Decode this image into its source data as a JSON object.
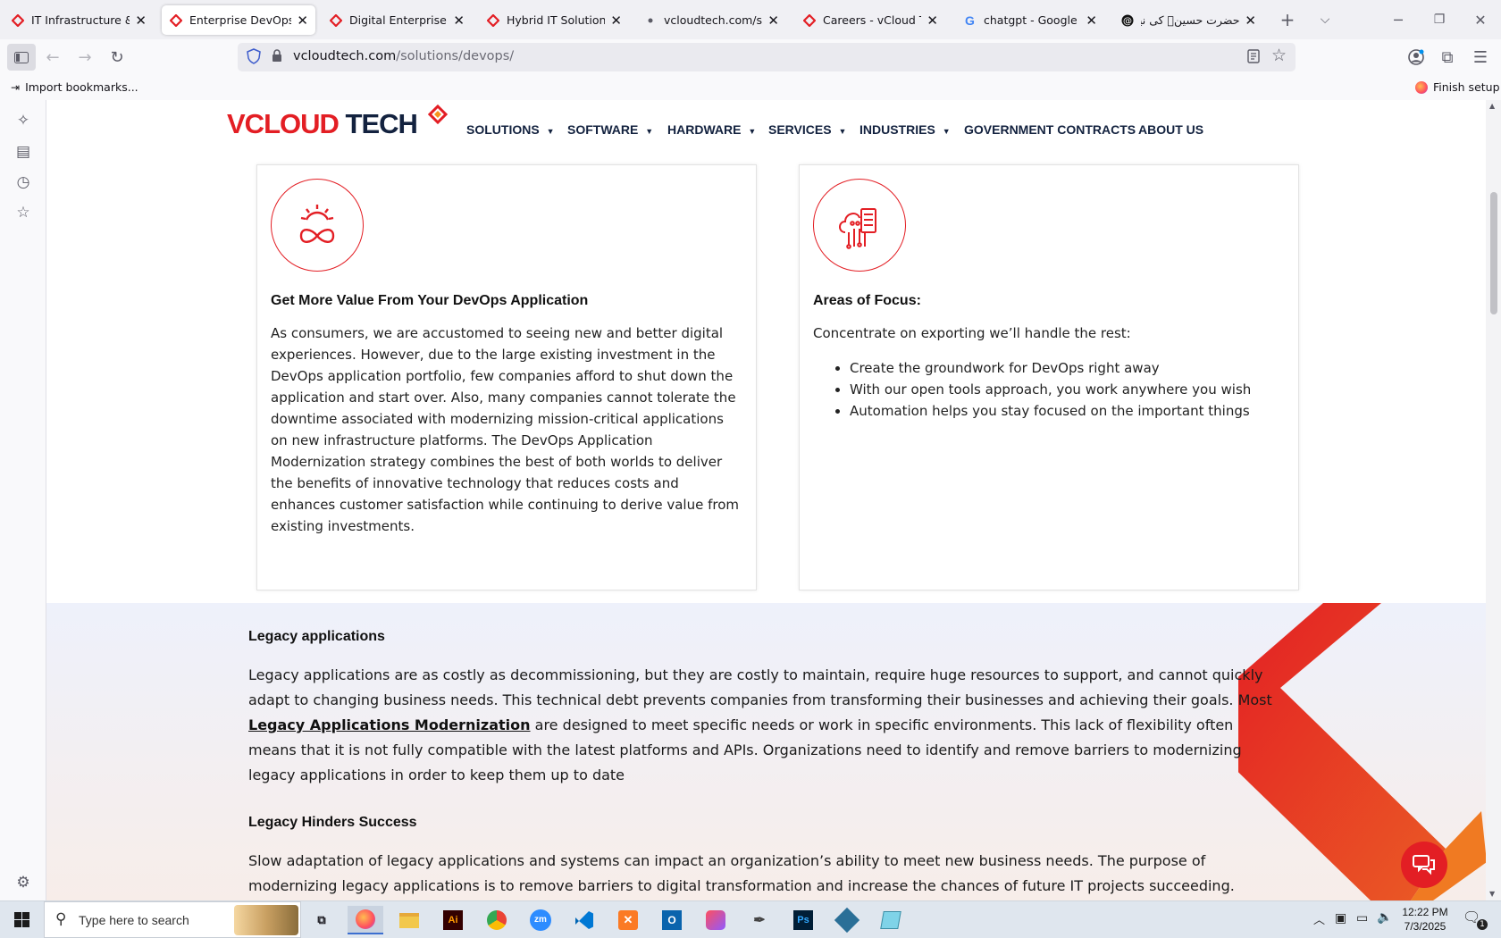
{
  "browser": {
    "tabs": [
      {
        "label": "IT Infrastructure & Cyb",
        "icon": "vcloud-favicon",
        "active": false
      },
      {
        "label": "Enterprise DevOps | De",
        "icon": "vcloud-favicon",
        "active": true
      },
      {
        "label": "Digital Enterprise Solut",
        "icon": "vcloud-favicon",
        "active": false
      },
      {
        "label": "Hybrid IT Solutions | IT",
        "icon": "vcloud-favicon",
        "active": false
      },
      {
        "label": "vcloudtech.com/solutio",
        "icon": "dot-icon",
        "active": false
      },
      {
        "label": "Careers - vCloud Tech",
        "icon": "vcloud-favicon",
        "active": false
      },
      {
        "label": "chatgpt - Google Searc",
        "icon": "google-icon",
        "active": false
      },
      {
        "label": "حضرت حسینؑ کی نیکی",
        "icon": "threads-icon",
        "active": false
      }
    ],
    "url_host": "vcloudtech.com",
    "url_path": "/solutions/devops/",
    "bookmarks_import": "Import bookmarks...",
    "finish_setup": "Finish setup"
  },
  "site": {
    "logo": {
      "part1": "VCLOUD",
      "part2": " TECH"
    },
    "menu": [
      "SOLUTIONS",
      "SOFTWARE",
      "HARDWARE",
      "SERVICES",
      "INDUSTRIES",
      "GOVERNMENT CONTRACTS",
      "ABOUT US"
    ],
    "card1": {
      "title": "Get More Value From Your DevOps Application",
      "body": "As consumers, we are accustomed to seeing new and better digital experiences. However, due to the large existing investment in the DevOps application portfolio, few companies afford to shut down the application and start over. Also, many companies cannot tolerate the downtime associated with modernizing mission-critical applications on new infrastructure platforms. The DevOps Application Modernization strategy combines the best of both worlds to deliver the benefits of innovative technology that reduces costs and enhances customer satisfaction while continuing to derive value from existing investments."
    },
    "card2": {
      "title": "Areas of Focus:",
      "intro": "Concentrate on exporting we’ll handle the rest:",
      "items": [
        "Create the groundwork for DevOps right away",
        "With our open tools approach, you work anywhere you wish",
        "Automation helps you stay focused on the important things"
      ]
    },
    "legacy": {
      "heading": "Legacy applications",
      "p1_before": "Legacy applications are as costly as decommissioning, but they are costly to maintain, require huge resources to support, and cannot quickly adapt to changing business needs. This technical debt prevents companies from transforming their businesses and achieving their goals. Most ",
      "p1_link": "Legacy Applications Modernization",
      "p1_after": " are designed to meet specific needs or work in specific environments. This lack of flexibility often means that it is not fully compatible with the latest platforms and APIs. Organizations need to identify and remove barriers to modernizing legacy applications in order to keep them up to date",
      "heading2": "Legacy Hinders Success",
      "p2": "Slow adaptation of legacy applications and systems can impact an organization’s ability to meet new business needs. The purpose of modernizing legacy applications is to remove barriers to digital transformation and increase the chances of future IT projects succeeding."
    }
  },
  "taskbar": {
    "search_placeholder": "Type here to search",
    "time": "12:22 PM",
    "date": "7/3/2025",
    "notifications": "1"
  },
  "colors": {
    "brand_red": "#e31e24",
    "brand_navy": "#13223f"
  }
}
